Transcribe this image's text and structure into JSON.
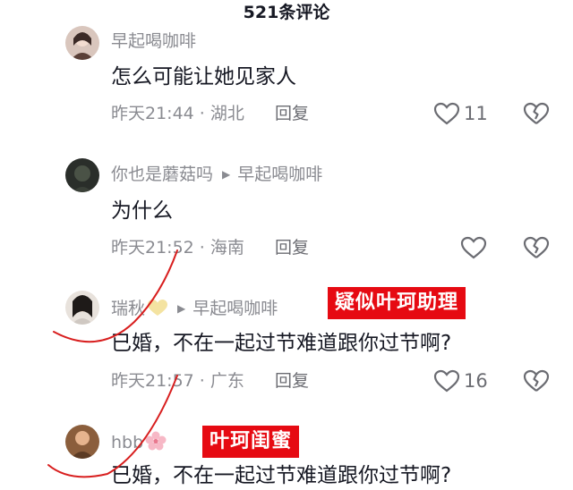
{
  "header": {
    "title": "521条评论"
  },
  "comments": [
    {
      "user": "早起喝咖啡",
      "reply_to": "",
      "content": "怎么可能让她见家人",
      "time": "昨天21:44",
      "location": "湖北",
      "reply_label": "回复",
      "likes": "11"
    },
    {
      "user": "你也是蘑菇吗",
      "reply_to": "早起喝咖啡",
      "content": "为什么",
      "time": "昨天21:52",
      "location": "海南",
      "reply_label": "回复",
      "likes": ""
    },
    {
      "user": "瑞秋",
      "reply_to": "早起喝咖啡",
      "content": "已婚，不在一起过节难道跟你过节啊?",
      "time": "昨天21:57",
      "location": "广东",
      "reply_label": "回复",
      "likes": "16",
      "tag": "疑似叶珂助理"
    },
    {
      "user": "hbb",
      "reply_to": "",
      "content": "已婚，不在一起过节难道跟你过节啊?",
      "tag": "叶珂闺蜜"
    }
  ],
  "meta_separator": " · ",
  "colors": {
    "tag_bg": "#e60a12",
    "annotation": "#d81e1e",
    "secondary_text": "#8a8b91"
  }
}
